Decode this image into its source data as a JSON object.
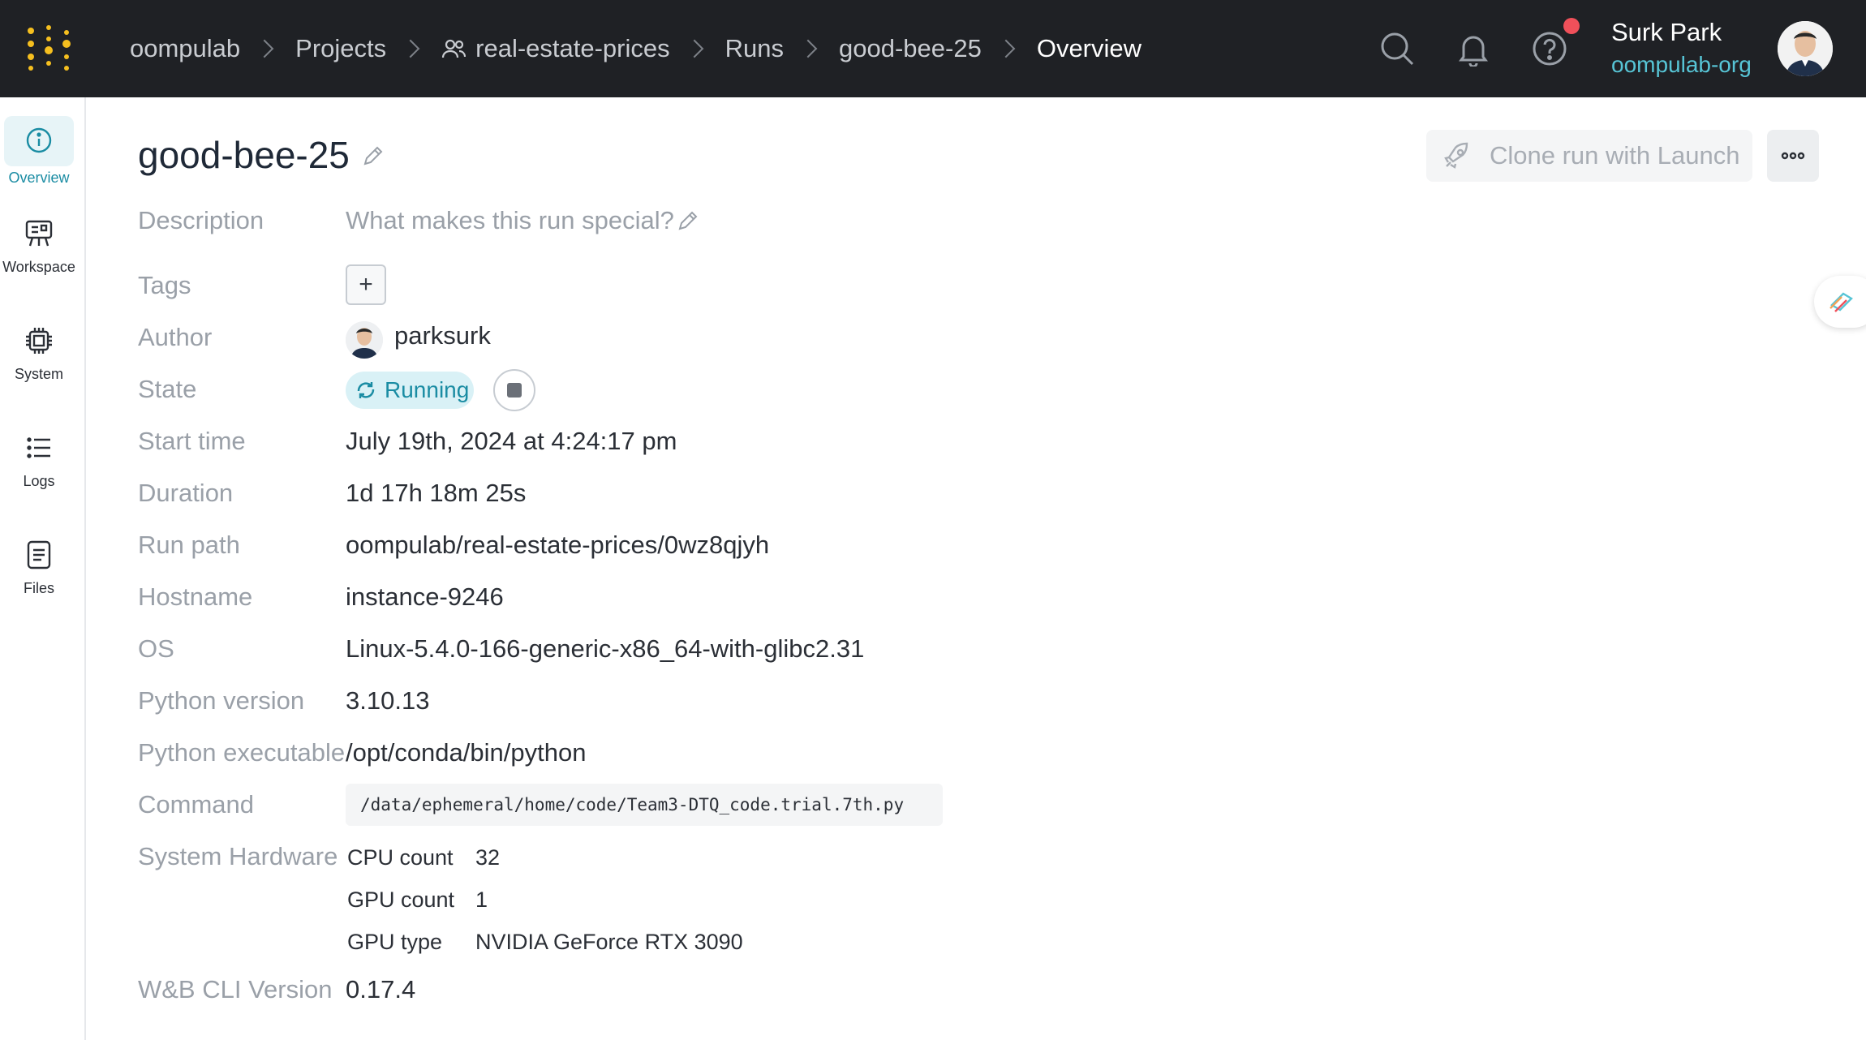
{
  "topbar": {
    "breadcrumbs": [
      "oompulab",
      "Projects",
      "real-estate-prices",
      "Runs",
      "good-bee-25",
      "Overview"
    ],
    "user_name": "Surk Park",
    "user_org": "oompulab-org"
  },
  "sidebar": {
    "items": [
      {
        "label": "Overview",
        "icon": "info-icon"
      },
      {
        "label": "Workspace",
        "icon": "workspace-icon"
      },
      {
        "label": "System",
        "icon": "cpu-icon"
      },
      {
        "label": "Logs",
        "icon": "list-icon"
      },
      {
        "label": "Files",
        "icon": "file-icon"
      }
    ]
  },
  "run": {
    "title": "good-bee-25",
    "clone_label": "Clone run with Launch",
    "labels": {
      "description": "Description",
      "tags": "Tags",
      "author": "Author",
      "state": "State",
      "start_time": "Start time",
      "duration": "Duration",
      "run_path": "Run path",
      "hostname": "Hostname",
      "os": "OS",
      "python_version": "Python version",
      "python_executable": "Python executable",
      "command": "Command",
      "system_hardware": "System Hardware",
      "cli_version": "W&B CLI Version"
    },
    "description_placeholder": "What makes this run special?",
    "tag_add": "+",
    "author": "parksurk",
    "state": "Running",
    "start_time": "July 19th, 2024 at 4:24:17 pm",
    "duration": "1d 17h 18m 25s",
    "run_path": "oompulab/real-estate-prices/0wz8qjyh",
    "hostname": "instance-9246",
    "os": "Linux-5.4.0-166-generic-x86_64-with-glibc2.31",
    "python_version": "3.10.13",
    "python_executable": "/opt/conda/bin/python",
    "command": "/data/ephemeral/home/code/Team3-DTQ_code.trial.7th.py",
    "hardware": [
      {
        "key": "CPU count",
        "value": "32"
      },
      {
        "key": "GPU count",
        "value": "1"
      },
      {
        "key": "GPU type",
        "value": "NVIDIA GeForce RTX 3090"
      }
    ],
    "cli_version": "0.17.4"
  },
  "colors": {
    "topbar_bg": "#1f2125",
    "accent": "#1a8ca3",
    "org_link": "#57c5d6",
    "logo_dots": "#f5bf1f",
    "notification": "#f0505a"
  }
}
